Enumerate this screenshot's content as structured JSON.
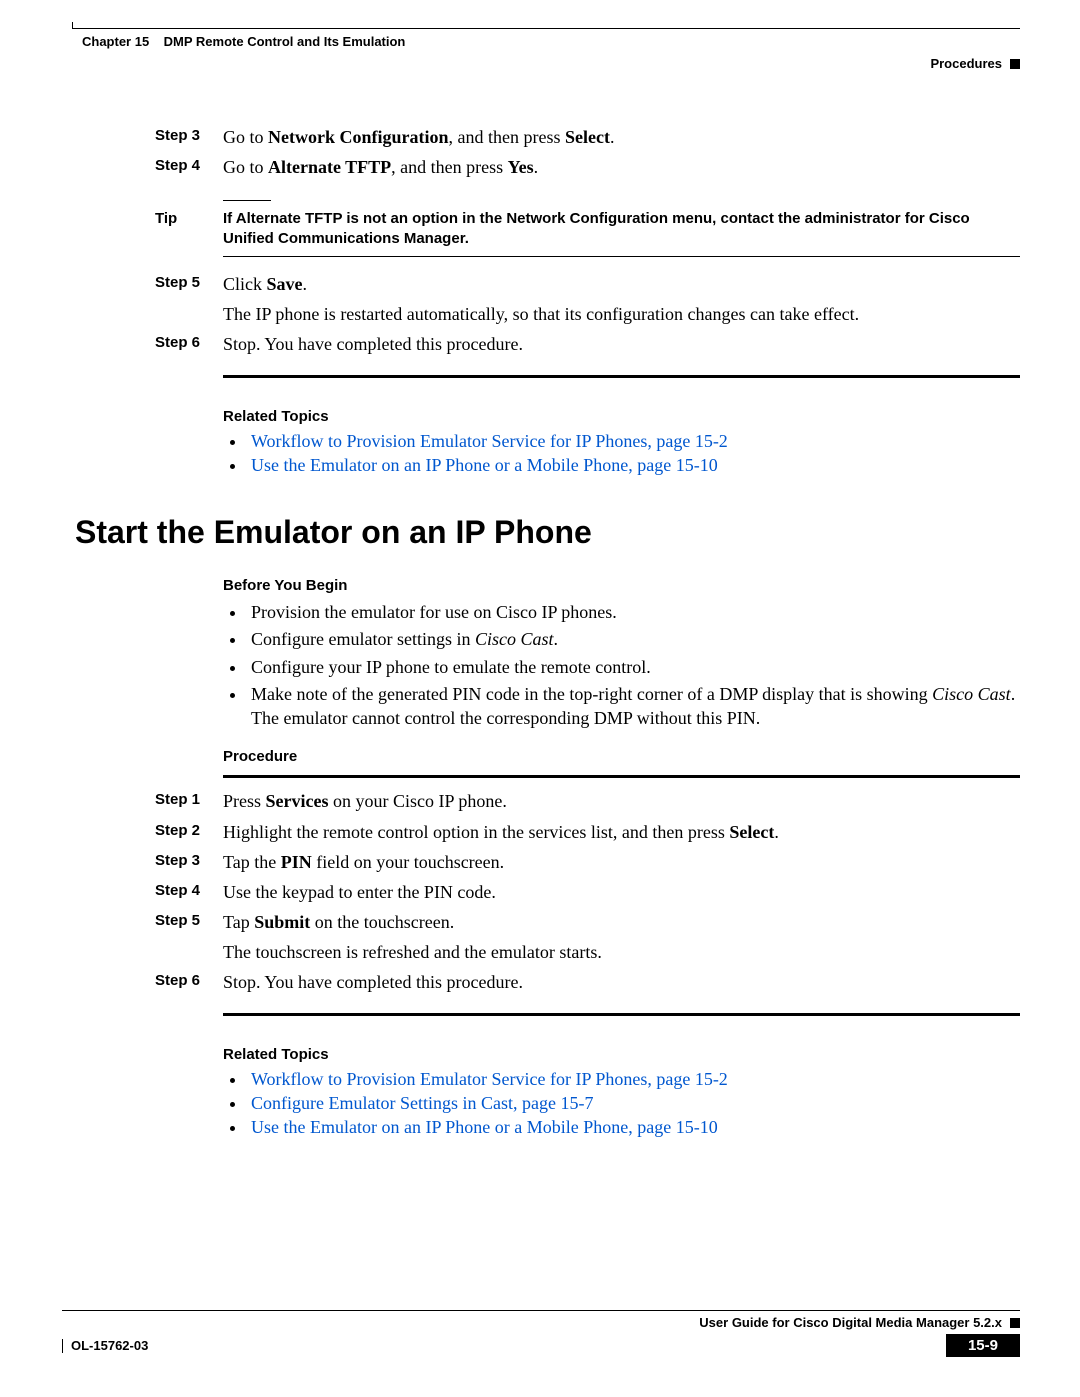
{
  "header": {
    "chapter_label": "Chapter 15",
    "chapter_title": "DMP Remote Control and Its Emulation",
    "section_label": "Procedures"
  },
  "first_block": {
    "steps": {
      "s3": {
        "label": "Step 3",
        "prefix": "Go to ",
        "b1": "Network Configuration",
        "mid": ", and then press ",
        "b2": "Select",
        "suffix": "."
      },
      "s4": {
        "label": "Step 4",
        "prefix": "Go to ",
        "b1": "Alternate TFTP",
        "mid": ", and then press ",
        "b2": "Yes",
        "suffix": "."
      },
      "s5": {
        "label": "Step 5",
        "prefix": "Click ",
        "b1": "Save",
        "suffix": "."
      },
      "s5_extra": "The IP phone is restarted automatically, so that its configuration changes can take effect.",
      "s6": {
        "label": "Step 6",
        "text": "Stop. You have completed this procedure."
      }
    },
    "tip": {
      "label": "Tip",
      "text": "If Alternate TFTP is not an option in the Network Configuration menu, contact the administrator for Cisco Unified Communications Manager."
    },
    "related_heading": "Related Topics",
    "related": [
      "Workflow to Provision Emulator Service for IP Phones, page 15-2",
      "Use the Emulator on an IP Phone or a Mobile Phone, page 15-10"
    ]
  },
  "section2": {
    "title": "Start the Emulator on an IP Phone",
    "byb_heading": "Before You Begin",
    "byb": [
      {
        "text": "Provision the emulator for use on Cisco IP phones."
      },
      {
        "prefix": "Configure emulator settings in ",
        "i1": "Cisco Cast",
        "suffix": "."
      },
      {
        "text": "Configure your IP phone to emulate the remote control."
      },
      {
        "prefix": "Make note of the generated PIN code in the top-right corner of a DMP display that is showing ",
        "i1": "Cisco Cast",
        "suffix": ". The emulator cannot control the corresponding DMP without this PIN."
      }
    ],
    "proc_heading": "Procedure",
    "steps": {
      "s1": {
        "label": "Step 1",
        "prefix": "Press ",
        "b1": "Services",
        "suffix": " on your Cisco IP phone."
      },
      "s2": {
        "label": "Step 2",
        "prefix": "Highlight the remote control option in the services list, and then press ",
        "b1": "Select",
        "suffix": "."
      },
      "s3": {
        "label": "Step 3",
        "prefix": "Tap the ",
        "b1": "PIN",
        "suffix": " field on your touchscreen."
      },
      "s4": {
        "label": "Step 4",
        "text": "Use the keypad to enter the PIN code."
      },
      "s5": {
        "label": "Step 5",
        "prefix": "Tap ",
        "b1": "Submit",
        "suffix": " on the touchscreen."
      },
      "s5_extra": "The touchscreen is refreshed and the emulator starts.",
      "s6": {
        "label": "Step 6",
        "text": "Stop. You have completed this procedure."
      }
    },
    "related_heading": "Related Topics",
    "related": [
      "Workflow to Provision Emulator Service for IP Phones, page 15-2",
      "Configure Emulator Settings in Cast, page 15-7",
      "Use the Emulator on an IP Phone or a Mobile Phone, page 15-10"
    ]
  },
  "footer": {
    "guide": "User Guide for Cisco Digital Media Manager 5.2.x",
    "docnum": "OL-15762-03",
    "pagenum": "15-9"
  }
}
